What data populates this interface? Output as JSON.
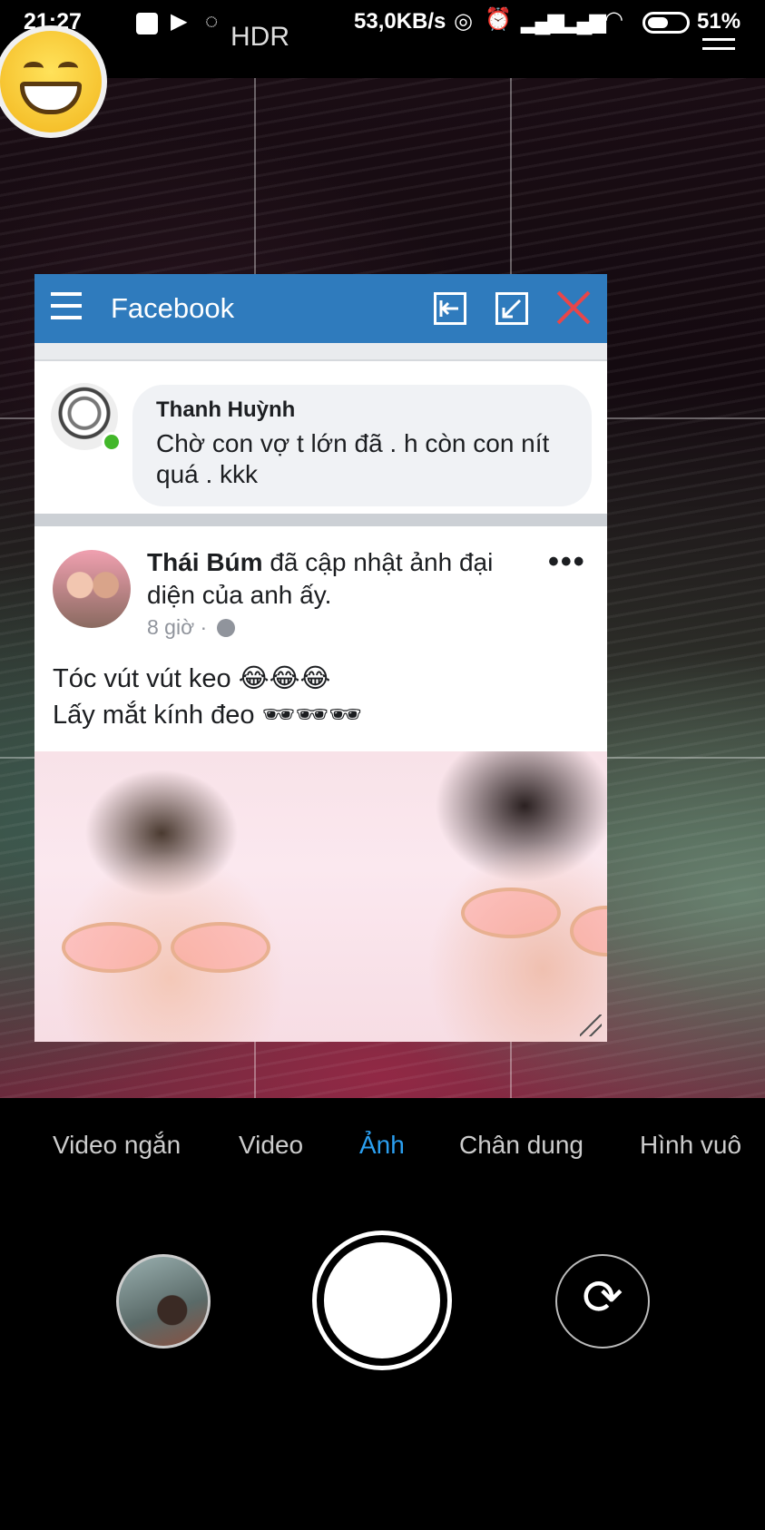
{
  "status_bar": {
    "time": "21:27",
    "hdr": "HDR",
    "network_speed": "53,0KB/s",
    "battery": "51%",
    "icons": [
      "notification-square-icon",
      "play-store-icon",
      "messenger-icon",
      "hotspot-icon",
      "alarm-icon",
      "signal-icon",
      "signal-icon",
      "wifi-icon",
      "battery-icon"
    ]
  },
  "chat_head": {
    "icon": "grinning-emoji-icon"
  },
  "facebook_window": {
    "title": "Facebook",
    "colors": {
      "header": "#2f7bbd",
      "close": "#e8464a"
    },
    "comment": {
      "author": "Thanh Huỳnh",
      "text": "Chờ con vợ t lớn đã . h còn con nít quá . kkk"
    },
    "post": {
      "author": "Thái Búm",
      "action": " đã cập nhật ảnh đại diện của anh ấy.",
      "time": "8 giờ ·",
      "more": "•••",
      "line1": "Tóc vút vút keo 😂😂😂",
      "line2": "Lấy mắt kính đeo 🕶🕶🕶"
    }
  },
  "camera": {
    "modes": [
      "Video ngắn",
      "Video",
      "Ảnh",
      "Chân dung",
      "Hình vuô"
    ],
    "active_mode": "Ảnh",
    "accent": "#2b9ff0"
  }
}
